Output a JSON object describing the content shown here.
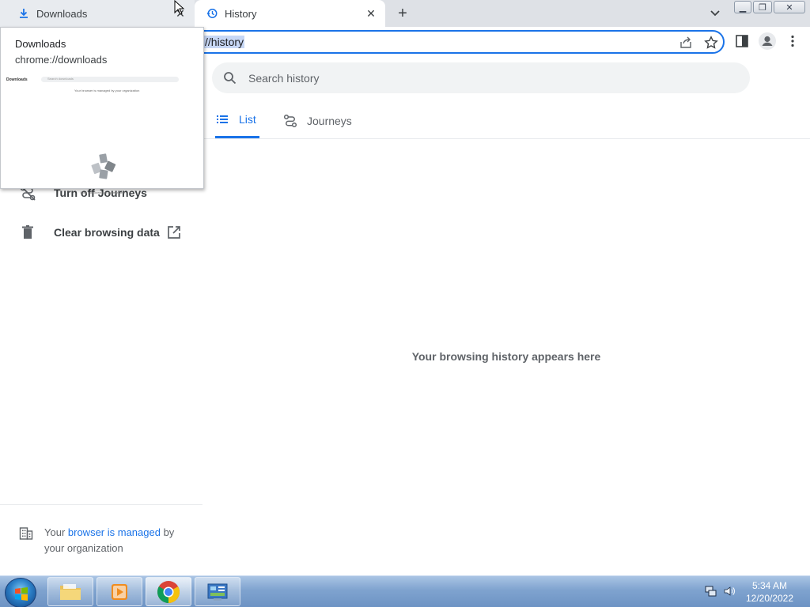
{
  "browser": {
    "tabs": [
      {
        "title": "Downloads",
        "icon": "download-icon"
      },
      {
        "title": "History",
        "icon": "history-icon"
      }
    ],
    "tab_close_glyph": "✕",
    "new_tab_glyph": "+",
    "window_controls": {
      "minimize": "▁",
      "maximize": "❐",
      "close": "✕"
    },
    "omnibox": {
      "url_text": "//history"
    }
  },
  "hovercard": {
    "title": "Downloads",
    "url": "chrome://downloads",
    "preview": {
      "title": "Downloads",
      "search_placeholder": "Search downloads",
      "managed_text": "Your browser is managed by your organization",
      "empty_text": "Files you download appear here"
    }
  },
  "history_page": {
    "search_placeholder": "Search history",
    "tabs": [
      {
        "label": "List",
        "icon": "list-icon",
        "selected": true
      },
      {
        "label": "Journeys",
        "icon": "journeys-icon",
        "selected": false
      }
    ],
    "empty_message": "Your browsing history appears here",
    "sidebar": {
      "items": [
        {
          "label": "Turn off Journeys",
          "icon": "journeys-off-icon"
        },
        {
          "label": "Clear browsing data",
          "icon": "trash-icon",
          "trailing_icon": "open-in-new-icon"
        }
      ],
      "managed": {
        "prefix": "Your ",
        "link": "browser is managed",
        "suffix": " by your organization"
      }
    },
    "accent_color": "#1a73e8"
  },
  "taskbar": {
    "apps": [
      "file-explorer-icon",
      "media-player-icon",
      "chrome-icon",
      "control-panel-icon"
    ],
    "clock_time": "5:34 AM",
    "clock_date": "12/20/2022"
  }
}
